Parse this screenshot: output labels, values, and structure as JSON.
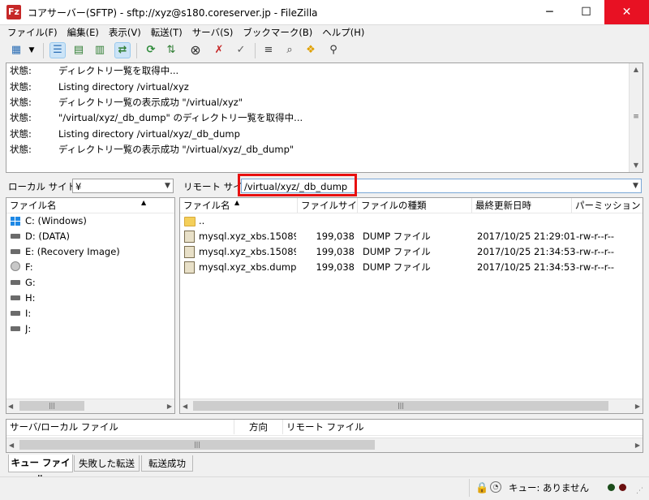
{
  "window": {
    "title": "コアサーバー(SFTP) - sftp://xyz@s180.coreserver.jp - FileZilla",
    "app_icon": "Fz",
    "min_glyph": "─",
    "max_glyph": "☐",
    "close_glyph": "✕"
  },
  "menu": [
    "ファイル(F)",
    "編集(E)",
    "表示(V)",
    "転送(T)",
    "サーバ(S)",
    "ブックマーク(B)",
    "ヘルプ(H)"
  ],
  "log": {
    "entries": [
      {
        "label": "状態:",
        "message": "ディレクトリ一覧を取得中..."
      },
      {
        "label": "状態:",
        "message": "Listing directory /virtual/xyz"
      },
      {
        "label": "状態:",
        "message": "ディレクトリ一覧の表示成功 \"/virtual/xyz\""
      },
      {
        "label": "状態:",
        "message": "\"/virtual/xyz/_db_dump\" のディレクトリ一覧を取得中..."
      },
      {
        "label": "状態:",
        "message": "Listing directory /virtual/xyz/_db_dump"
      },
      {
        "label": "状態:",
        "message": "ディレクトリ一覧の表示成功 \"/virtual/xyz/_db_dump\""
      }
    ]
  },
  "local": {
    "site_label": "ローカル サイト:",
    "path": "¥",
    "column": "ファイル名",
    "drives": [
      {
        "name": "C: (Windows)",
        "icon": "windows-drive-icon"
      },
      {
        "name": "D: (DATA)",
        "icon": "drive-icon"
      },
      {
        "name": "E: (Recovery Image)",
        "icon": "drive-icon"
      },
      {
        "name": "F:",
        "icon": "cd-drive-icon"
      },
      {
        "name": "G:",
        "icon": "drive-icon"
      },
      {
        "name": "H:",
        "icon": "drive-icon"
      },
      {
        "name": "I:",
        "icon": "drive-icon"
      },
      {
        "name": "J:",
        "icon": "drive-icon"
      }
    ]
  },
  "remote": {
    "site_label": "リモート サイト:",
    "path": "/virtual/xyz/_db_dump",
    "columns": {
      "name": "ファイル名",
      "size": "ファイルサイズ",
      "type": "ファイルの種類",
      "modified": "最終更新日時",
      "perms": "パーミッション"
    },
    "files": [
      {
        "name": "..",
        "size": "",
        "type": "",
        "modified": "",
        "perms": "",
        "kind": "folder"
      },
      {
        "name": "mysql.xyz_xbs.15089...",
        "size": "199,038",
        "type": "DUMP ファイル",
        "modified": "2017/10/25 21:29:01",
        "perms": "-rw-r--r--",
        "kind": "file"
      },
      {
        "name": "mysql.xyz_xbs.15089...",
        "size": "199,038",
        "type": "DUMP ファイル",
        "modified": "2017/10/25 21:34:53",
        "perms": "-rw-r--r--",
        "kind": "file"
      },
      {
        "name": "mysql.xyz_xbs.dump",
        "size": "199,038",
        "type": "DUMP ファイル",
        "modified": "2017/10/25 21:34:53",
        "perms": "-rw-r--r--",
        "kind": "file"
      }
    ]
  },
  "queue": {
    "col_server": "サーバ/ローカル ファイル",
    "col_direction": "方向",
    "col_remote": "リモート ファイル"
  },
  "tabs": [
    "キュー ファイル",
    "失敗した転送",
    "転送成功"
  ],
  "status": {
    "queue_text": "キュー: ありません"
  },
  "colors": {
    "highlight": "#e81010",
    "close_button": "#e81123",
    "selected_toolbar": "#cce4f7"
  }
}
